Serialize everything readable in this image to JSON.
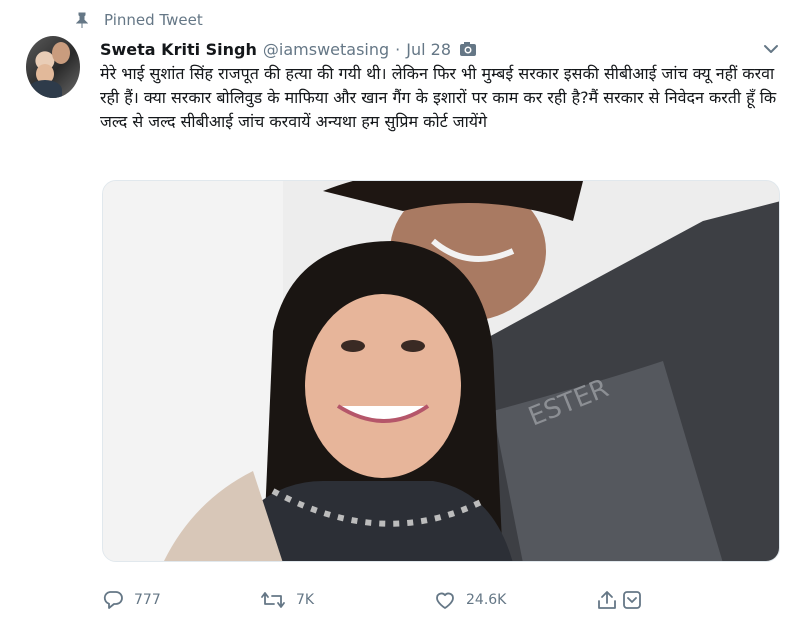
{
  "pinned_label": "Pinned Tweet",
  "author": {
    "name": "Sweta Kriti Singh",
    "handle": "@iamswetasing",
    "separator": "·",
    "date": "Jul 28"
  },
  "tweet_text": "मेरे भाई सुशांत सिंह राजपूत की हत्या की गयी थी। लेकिन फिर भी मुम्बई सरकार इसकी सीबीआई जांच क्यू नहीं करवा रही हैं। क्या सरकार बोलिवुड के माफिया और खान गैंग के इशारों पर काम कर रही है?मैं सरकार से निवेदन करती हूँ कि जल्द से जल्द सीबीआई जांच करवायें अन्यथा हम सुप्रिम कोर्ट जायेंगे",
  "actions": {
    "replies": "777",
    "retweets": "7K",
    "likes": "24.6K"
  },
  "colors": {
    "text_primary": "#14171a",
    "text_secondary": "#657786",
    "background": "#ffffff"
  },
  "icons": [
    "pin-icon",
    "camera-icon",
    "chevron-down-icon",
    "reply-icon",
    "retweet-icon",
    "like-icon",
    "share-icon"
  ]
}
